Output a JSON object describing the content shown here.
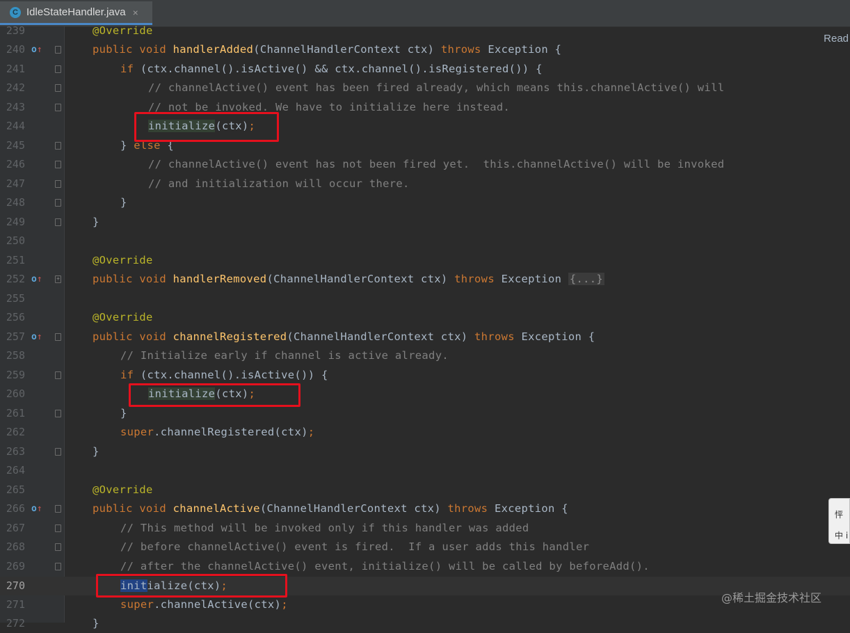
{
  "tab": {
    "icon_letter": "C",
    "title": "IdleStateHandler.java",
    "close": "×"
  },
  "reader_mode": "Read",
  "lines": {
    "n239": "239",
    "n240": "240",
    "n241": "241",
    "n242": "242",
    "n243": "243",
    "n244": "244",
    "n245": "245",
    "n246": "246",
    "n247": "247",
    "n248": "248",
    "n249": "249",
    "n250": "250",
    "n251": "251",
    "n252": "252",
    "n255": "255",
    "n256": "256",
    "n257": "257",
    "n258": "258",
    "n259": "259",
    "n260": "260",
    "n261": "261",
    "n262": "262",
    "n263": "263",
    "n264": "264",
    "n265": "265",
    "n266": "266",
    "n267": "267",
    "n268": "268",
    "n269": "269",
    "n270": "270",
    "n271": "271",
    "n272": "272"
  },
  "code": {
    "override": "@Override",
    "public_void": "public void ",
    "handlerAdded": "handlerAdded",
    "handlerRemoved": "handlerRemoved",
    "channelRegistered": "channelRegistered",
    "channelActive": "channelActive",
    "params": "(ChannelHandlerContext ctx) ",
    "throws": "throws",
    "exception_open": " Exception {",
    "exception": " Exception ",
    "folded_body": "{...}",
    "if_kw": "if",
    "cond_241": " (ctx.channel().isActive() && ctx.channel().isRegistered()) {",
    "comment_242": "// channelActive() event has been fired already, which means this.channelActive() will",
    "comment_243": "// not be invoked. We have to initialize here instead.",
    "initialize": "initialize",
    "init_sel": "init",
    "init_rest": "ialize",
    "call_args": "(ctx)",
    "semicolon": ";",
    "close_brace_space": "} ",
    "else_kw": "else",
    "open_brace": " {",
    "comment_246": "// channelActive() event has not been fired yet.  this.channelActive() will be invoked",
    "comment_247": "// and initialization will occur there.",
    "close_brace": "}",
    "comment_258": "// Initialize early if channel is active already.",
    "cond_259": " (ctx.channel().isActive()) {",
    "super_kw": "super",
    "super_registered": ".channelRegistered(ctx)",
    "comment_267": "// This method will be invoked only if this handler was added",
    "comment_268": "// before channelActive() event is fired.  If a user adds this handler",
    "comment_269": "// after the channelActive() event, initialize() will be called by beforeAdd().",
    "super_active": ".channelActive(ctx)"
  },
  "markers": {
    "override_o": "o",
    "override_arrow": "↑"
  },
  "side_widget": {
    "top": "怦",
    "bottom": "中 ⅰ"
  },
  "watermark": "@稀土掘金技术社区",
  "colors": {
    "background": "#2b2b2b",
    "keyword": "#cc7832",
    "annotation": "#bbb529",
    "method": "#ffc66d",
    "comment": "#808080",
    "highlight_box": "#e5101d"
  }
}
